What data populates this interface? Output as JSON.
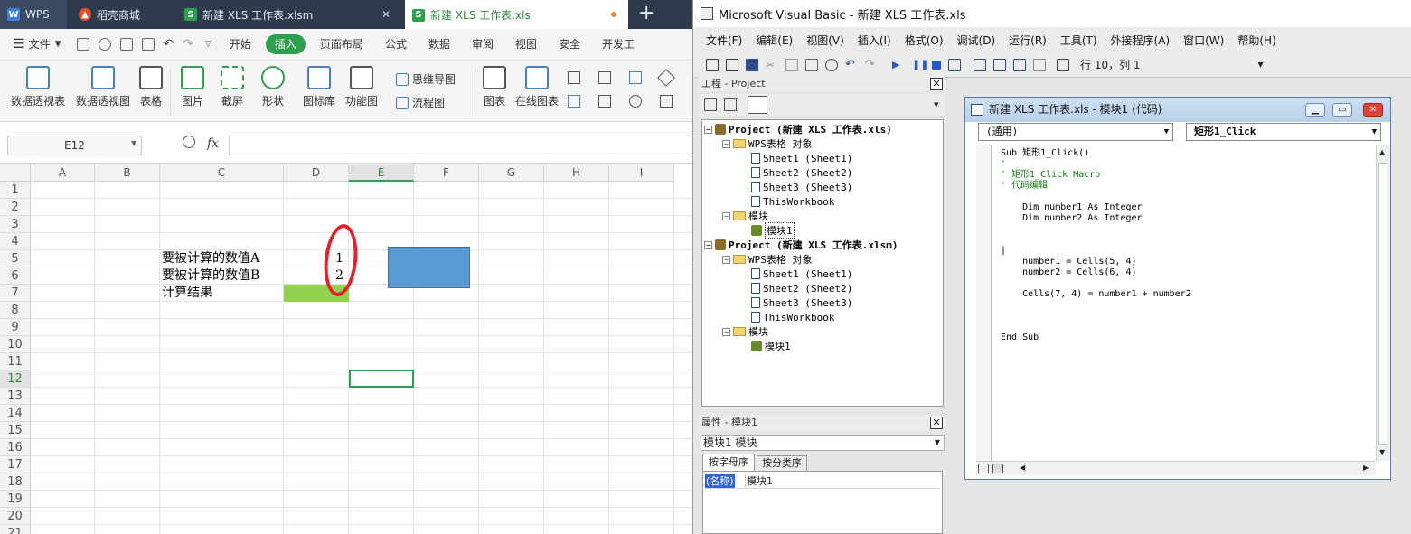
{
  "wps": {
    "tabs": [
      {
        "label": "WPS",
        "icon": "wps-logo-icon"
      },
      {
        "label": "稻壳商城",
        "icon": "daoke-flame-icon"
      },
      {
        "label": "新建 XLS 工作表.xlsm",
        "icon": "spreadsheet-s-icon"
      },
      {
        "label": "新建 XLS 工作表.xls",
        "icon": "spreadsheet-s-icon"
      }
    ],
    "new_tab": "+",
    "menu": {
      "file": "文件",
      "items": [
        "开始",
        "插入",
        "页面布局",
        "公式",
        "数据",
        "审阅",
        "视图",
        "安全",
        "开发工"
      ],
      "selected": "插入"
    },
    "ribbon": {
      "big": [
        "数据透视表",
        "数据透视图",
        "表格",
        "图片",
        "截屏",
        "形状",
        "图标库",
        "功能图",
        "图表",
        "在线图表"
      ],
      "small": [
        "思维导图",
        "流程图"
      ]
    },
    "namebox": "E12",
    "fx": "fx",
    "columns": [
      "A",
      "B",
      "C",
      "D",
      "E",
      "F",
      "G",
      "H",
      "I"
    ],
    "rows": [
      "1",
      "2",
      "3",
      "4",
      "5",
      "6",
      "7",
      "8",
      "9",
      "10",
      "11",
      "12",
      "13",
      "14",
      "15",
      "16",
      "17",
      "18",
      "19",
      "20",
      "21"
    ],
    "cells": {
      "c5": "要被计算的数值A",
      "c6": "要被计算的数值B",
      "c7": "计算结果",
      "d5": "1",
      "d6": "2"
    },
    "colors": {
      "accent": "#2e9e4f",
      "shape": "#5b9bd5",
      "result_fill": "#92d050",
      "circle": "#e8202a"
    }
  },
  "vbe": {
    "title": "Microsoft Visual Basic - 新建 XLS 工作表.xls",
    "menu": [
      "文件(F)",
      "编辑(E)",
      "视图(V)",
      "插入(I)",
      "格式(O)",
      "调试(D)",
      "运行(R)",
      "工具(T)",
      "外接程序(A)",
      "窗口(W)",
      "帮助(H)"
    ],
    "status": "行 10，列 1",
    "project_title": "工程 - Project",
    "tree": [
      {
        "label": "Project (新建 XLS 工作表.xls)",
        "bold": true
      },
      {
        "label": "WPS表格 对象"
      },
      {
        "label": "Sheet1 (Sheet1)"
      },
      {
        "label": "Sheet2 (Sheet2)"
      },
      {
        "label": "Sheet3 (Sheet3)"
      },
      {
        "label": "ThisWorkbook"
      },
      {
        "label": "模块"
      },
      {
        "label": "模块1"
      },
      {
        "label": "Project (新建 XLS 工作表.xlsm)",
        "bold": true
      },
      {
        "label": "WPS表格 对象"
      },
      {
        "label": "Sheet1 (Sheet1)"
      },
      {
        "label": "Sheet2 (Sheet2)"
      },
      {
        "label": "Sheet3 (Sheet3)"
      },
      {
        "label": "ThisWorkbook"
      },
      {
        "label": "模块"
      },
      {
        "label": "模块1"
      }
    ],
    "props_title": "属性 - 模块1",
    "props_combo": "模块1 模块",
    "props_tabs": [
      "按字母序",
      "按分类序"
    ],
    "props_row": {
      "key": "(名称)",
      "value": "模块1"
    },
    "code_window": {
      "title": "新建 XLS 工作表.xls - 模块1 (代码)",
      "object_combo": "(通用)",
      "proc_combo": "矩形1_Click",
      "lines": [
        {
          "text": "Sub 矩形1_Click()",
          "comment": false
        },
        {
          "text": "'",
          "comment": true
        },
        {
          "text": "' 矩形1_Click Macro",
          "comment": true
        },
        {
          "text": "' 代码编辑",
          "comment": true
        },
        {
          "text": "",
          "comment": false
        },
        {
          "text": "    Dim number1 As Integer",
          "comment": false
        },
        {
          "text": "    Dim number2 As Integer",
          "comment": false
        },
        {
          "text": "",
          "comment": false
        },
        {
          "text": "",
          "comment": false
        },
        {
          "text": "|",
          "comment": false
        },
        {
          "text": "    number1 = Cells(5, 4)",
          "comment": false
        },
        {
          "text": "    number2 = Cells(6, 4)",
          "comment": false
        },
        {
          "text": "",
          "comment": false
        },
        {
          "text": "    Cells(7, 4) = number1 + number2",
          "comment": false
        },
        {
          "text": "",
          "comment": false
        },
        {
          "text": "",
          "comment": false
        },
        {
          "text": "",
          "comment": false
        },
        {
          "text": "End Sub",
          "comment": false
        }
      ]
    }
  }
}
